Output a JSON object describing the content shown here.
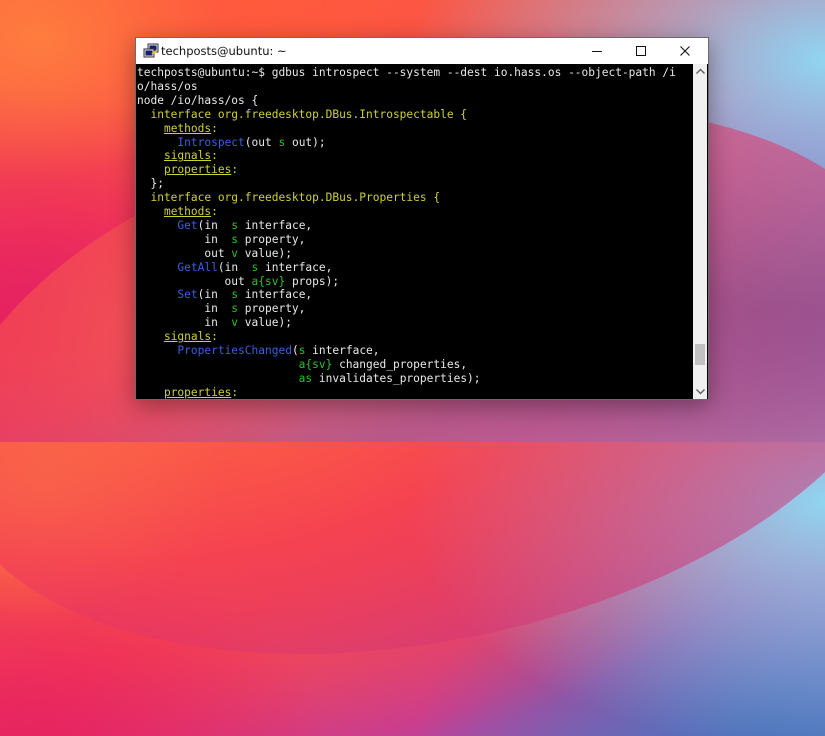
{
  "window": {
    "title": "techposts@ubuntu: ~",
    "icons": [
      "putty-icon",
      "minimize-icon",
      "maximize-icon",
      "close-icon",
      "scroll-up-icon",
      "scroll-down-icon"
    ]
  },
  "scrollbar": {
    "position_fraction": 0.93,
    "thumb_fraction": 0.07
  },
  "terminal": {
    "colors": {
      "default": "#e8e8e8",
      "keyword": "#cfcf3a",
      "method": "#3a5fe0",
      "type": "#29c229"
    },
    "lines": [
      [
        {
          "t": "techposts@ubuntu:~$ gdbus introspect --system --dest io.hass.os --object-path /i",
          "c": "default"
        }
      ],
      [
        {
          "t": "o/hass/os",
          "c": "default"
        }
      ],
      [
        {
          "t": "node /io/hass/os {",
          "c": "default"
        }
      ],
      [
        {
          "t": "  interface org.freedesktop.DBus.Introspectable {",
          "c": "keyword"
        }
      ],
      [
        {
          "t": "    ",
          "c": "default"
        },
        {
          "t": "methods",
          "c": "keyword",
          "u": true
        },
        {
          "t": ":",
          "c": "keyword"
        }
      ],
      [
        {
          "t": "      ",
          "c": "default"
        },
        {
          "t": "Introspect",
          "c": "method"
        },
        {
          "t": "(out ",
          "c": "default"
        },
        {
          "t": "s",
          "c": "type"
        },
        {
          "t": " out);",
          "c": "default"
        }
      ],
      [
        {
          "t": "    ",
          "c": "default"
        },
        {
          "t": "signals",
          "c": "keyword",
          "u": true
        },
        {
          "t": ":",
          "c": "keyword"
        }
      ],
      [
        {
          "t": "    ",
          "c": "default"
        },
        {
          "t": "properties",
          "c": "keyword",
          "u": true
        },
        {
          "t": ":",
          "c": "keyword"
        }
      ],
      [
        {
          "t": "  };",
          "c": "default"
        }
      ],
      [
        {
          "t": "  interface org.freedesktop.DBus.Properties {",
          "c": "keyword"
        }
      ],
      [
        {
          "t": "    ",
          "c": "default"
        },
        {
          "t": "methods",
          "c": "keyword",
          "u": true
        },
        {
          "t": ":",
          "c": "keyword"
        }
      ],
      [
        {
          "t": "      ",
          "c": "default"
        },
        {
          "t": "Get",
          "c": "method"
        },
        {
          "t": "(in  ",
          "c": "default"
        },
        {
          "t": "s",
          "c": "type"
        },
        {
          "t": " interface,",
          "c": "default"
        }
      ],
      [
        {
          "t": "          in  ",
          "c": "default"
        },
        {
          "t": "s",
          "c": "type"
        },
        {
          "t": " property,",
          "c": "default"
        }
      ],
      [
        {
          "t": "          out ",
          "c": "default"
        },
        {
          "t": "v",
          "c": "type"
        },
        {
          "t": " value);",
          "c": "default"
        }
      ],
      [
        {
          "t": "      ",
          "c": "default"
        },
        {
          "t": "GetAll",
          "c": "method"
        },
        {
          "t": "(in  ",
          "c": "default"
        },
        {
          "t": "s",
          "c": "type"
        },
        {
          "t": " interface,",
          "c": "default"
        }
      ],
      [
        {
          "t": "             out ",
          "c": "default"
        },
        {
          "t": "a{sv}",
          "c": "type"
        },
        {
          "t": " props);",
          "c": "default"
        }
      ],
      [
        {
          "t": "      ",
          "c": "default"
        },
        {
          "t": "Set",
          "c": "method"
        },
        {
          "t": "(in  ",
          "c": "default"
        },
        {
          "t": "s",
          "c": "type"
        },
        {
          "t": " interface,",
          "c": "default"
        }
      ],
      [
        {
          "t": "          in  ",
          "c": "default"
        },
        {
          "t": "s",
          "c": "type"
        },
        {
          "t": " property,",
          "c": "default"
        }
      ],
      [
        {
          "t": "          in  ",
          "c": "default"
        },
        {
          "t": "v",
          "c": "type"
        },
        {
          "t": " value);",
          "c": "default"
        }
      ],
      [
        {
          "t": "    ",
          "c": "default"
        },
        {
          "t": "signals",
          "c": "keyword",
          "u": true
        },
        {
          "t": ":",
          "c": "keyword"
        }
      ],
      [
        {
          "t": "      ",
          "c": "default"
        },
        {
          "t": "PropertiesChanged",
          "c": "method"
        },
        {
          "t": "(",
          "c": "default"
        },
        {
          "t": "s",
          "c": "type"
        },
        {
          "t": " interface,",
          "c": "default"
        }
      ],
      [
        {
          "t": "                        ",
          "c": "default"
        },
        {
          "t": "a{sv}",
          "c": "type"
        },
        {
          "t": " changed_properties,",
          "c": "default"
        }
      ],
      [
        {
          "t": "                        ",
          "c": "default"
        },
        {
          "t": "as",
          "c": "type"
        },
        {
          "t": " invalidates_properties);",
          "c": "default"
        }
      ],
      [
        {
          "t": "    ",
          "c": "default"
        },
        {
          "t": "properties",
          "c": "keyword",
          "u": true
        },
        {
          "t": ":",
          "c": "keyword"
        }
      ]
    ]
  }
}
